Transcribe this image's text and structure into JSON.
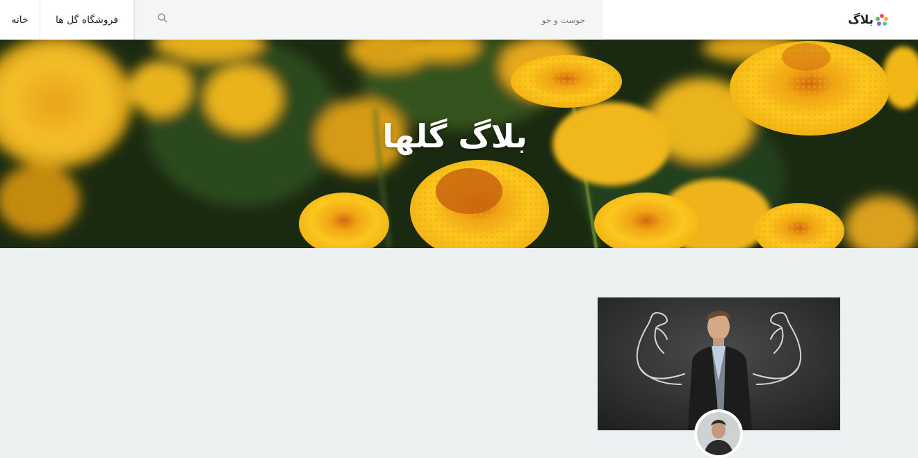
{
  "header": {
    "brand": "بلاگ",
    "search": {
      "placeholder": "جوست و جو",
      "value": ""
    },
    "nav": {
      "shop_label": "فروشگاه گل ها",
      "home_label": "خانه"
    }
  },
  "hero": {
    "title": "بلاگ گلها"
  },
  "icons": {
    "brand_logo": "colorful-flower-logo-icon",
    "search": "search-icon"
  },
  "colors": {
    "page_background": "#edf1f1",
    "navbar_background": "#ffffff",
    "search_background": "#f4f5f5",
    "flower_yellow": "#f7c21a",
    "text_dark": "#222222"
  }
}
